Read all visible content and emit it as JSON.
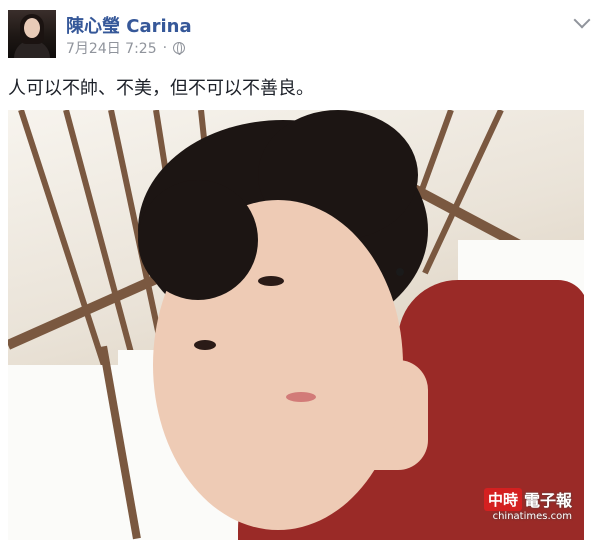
{
  "post": {
    "author_name": "陳心瑩 Carina",
    "timestamp": "7月24日 7:25",
    "audience_icon": "globe-icon",
    "menu_icon": "chevron-down-icon",
    "text": "人可以不帥、不美，但不可以不善良。"
  },
  "photo": {
    "watermark_brand": "中時",
    "watermark_text": "電子報",
    "watermark_url": "chinatimes.com"
  },
  "colors": {
    "name_link": "#365899",
    "meta_gray": "#90949c",
    "kimono_red": "#9a2a27",
    "watermark_red": "#d42020"
  }
}
